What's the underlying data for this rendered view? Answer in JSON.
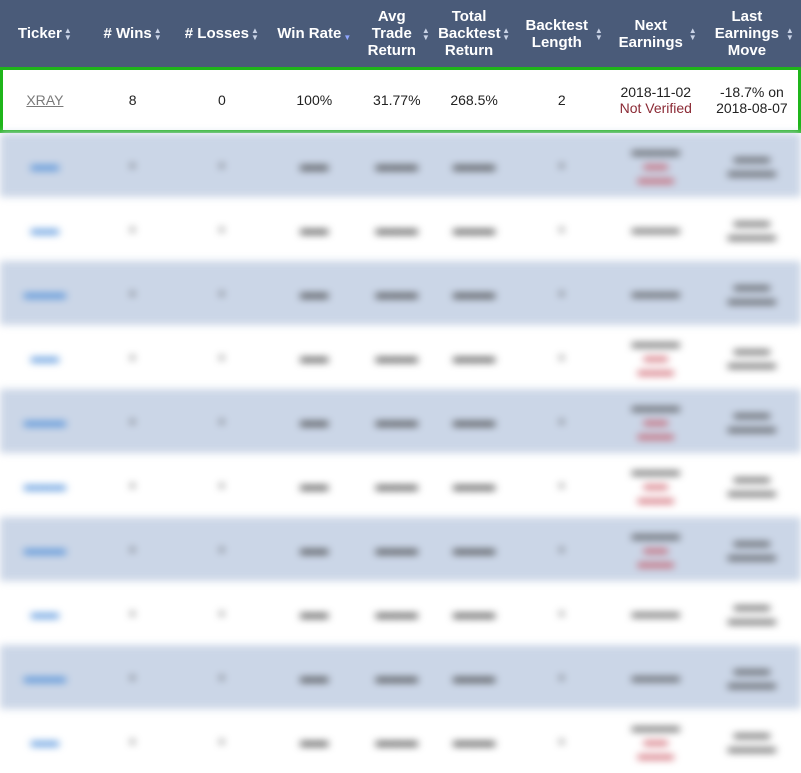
{
  "headers": [
    {
      "label": "Ticker",
      "sort": "both"
    },
    {
      "label": "# Wins",
      "sort": "both"
    },
    {
      "label": "# Losses",
      "sort": "both"
    },
    {
      "label": "Win Rate",
      "sort": "desc"
    },
    {
      "label": "Avg Trade Return",
      "sort": "both"
    },
    {
      "label": "Total Backtest Return",
      "sort": "both"
    },
    {
      "label": "Backtest Length",
      "sort": "both"
    },
    {
      "label": "Next Earnings",
      "sort": "both"
    },
    {
      "label": "Last Earnings Move",
      "sort": "both"
    }
  ],
  "highlight_row": {
    "ticker": "XRAY",
    "wins": "8",
    "losses": "0",
    "win_rate": "100%",
    "avg_return": "31.77%",
    "total_return": "268.5%",
    "length": "2",
    "next_earnings_date": "2018-11-02",
    "next_earnings_status": "Not Verified",
    "last_move_pct": "-18.7% on",
    "last_move_date": "2018-08-07"
  },
  "colors": {
    "header_bg": "#4a5b79",
    "highlight_border": "#1fb51a",
    "stripe": "#cbd6e7",
    "link": "#3a82d6",
    "not_verified": "#8b2a35"
  }
}
